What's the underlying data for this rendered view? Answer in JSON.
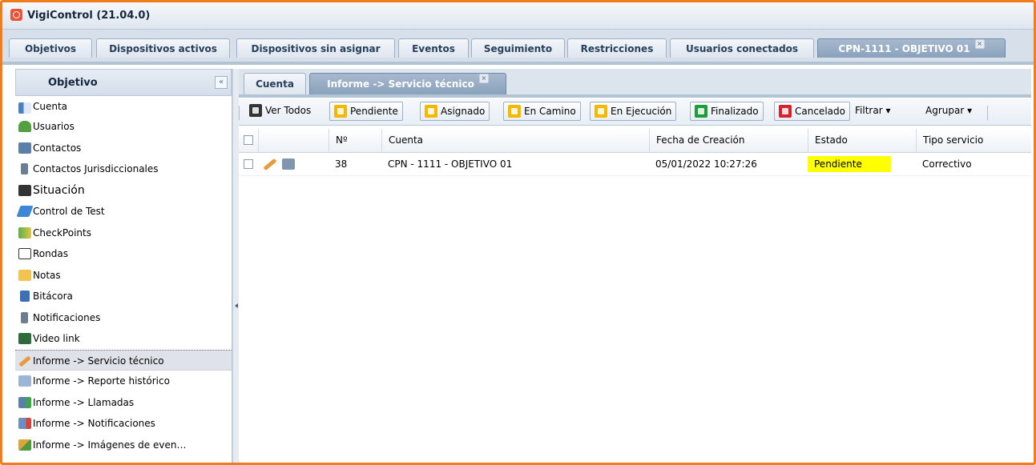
{
  "app": {
    "title": "VigiControl (21.04.0)"
  },
  "main_tabs": [
    {
      "label": "Objetivos"
    },
    {
      "label": "Dispositivos activos"
    },
    {
      "label": "Dispositivos sin asignar"
    },
    {
      "label": "Eventos"
    },
    {
      "label": "Seguimiento"
    },
    {
      "label": "Restricciones"
    },
    {
      "label": "Usuarios conectados"
    },
    {
      "label": "CPN-1111 - OBJETIVO 01",
      "active": true,
      "closable": true
    }
  ],
  "sidebar": {
    "title": "Objetivo",
    "collapse_icon": "«",
    "items": [
      {
        "label": "Cuenta",
        "icon": "card-icon"
      },
      {
        "label": "Usuarios",
        "icon": "users-icon"
      },
      {
        "label": "Contactos",
        "icon": "phone-icon"
      },
      {
        "label": "Contactos Jurisdiccionales",
        "icon": "mobile-icon"
      },
      {
        "label": "Situación",
        "icon": "binoculars-icon"
      },
      {
        "label": "Control de Test",
        "icon": "satellite-icon"
      },
      {
        "label": "CheckPoints",
        "icon": "map-icon"
      },
      {
        "label": "Rondas",
        "icon": "route-icon"
      },
      {
        "label": "Notas",
        "icon": "note-icon"
      },
      {
        "label": "Bitácora",
        "icon": "book-icon"
      },
      {
        "label": "Notificaciones",
        "icon": "mobile-icon"
      },
      {
        "label": "Video link",
        "icon": "film-icon"
      },
      {
        "label": "Informe -> Servicio técnico",
        "icon": "wrench-icon",
        "selected": true
      },
      {
        "label": "Informe -> Reporte histórico",
        "icon": "report-icon"
      },
      {
        "label": "Informe -> Llamadas",
        "icon": "phone-call-icon"
      },
      {
        "label": "Informe -> Notificaciones",
        "icon": "notify-icon"
      },
      {
        "label": "Informe -> Imágenes de even…",
        "icon": "images-icon"
      }
    ]
  },
  "sub_tabs": [
    {
      "label": "Cuenta"
    },
    {
      "label": "Informe -> Servicio técnico",
      "active": true,
      "closable": true
    }
  ],
  "toolbar": {
    "view_all": "Ver Todos",
    "filters": [
      {
        "label": "Pendiente",
        "color": "#f5b800"
      },
      {
        "label": "Asignado",
        "color": "#f5b800"
      },
      {
        "label": "En Camino",
        "color": "#f5b800"
      },
      {
        "label": "En Ejecución",
        "color": "#f5b800"
      },
      {
        "label": "Finalizado",
        "color": "#1e9e3b"
      },
      {
        "label": "Cancelado",
        "color": "#d6212e"
      }
    ],
    "filter_menu": "Filtrar ▾",
    "group_menu": "Agrupar ▾"
  },
  "grid": {
    "columns": [
      "",
      "",
      "Nº",
      "Cuenta",
      "Fecha de Creación",
      "Estado",
      "Tipo servicio"
    ],
    "rows": [
      {
        "num": "38",
        "cuenta": "CPN - 1111 - OBJETIVO 01",
        "fecha": "05/01/2022 10:27:26",
        "estado": "Pendiente",
        "tipo": "Correctivo"
      }
    ]
  },
  "colors": {
    "frame": "#f07c1c",
    "status_pending": "#ffff00"
  }
}
